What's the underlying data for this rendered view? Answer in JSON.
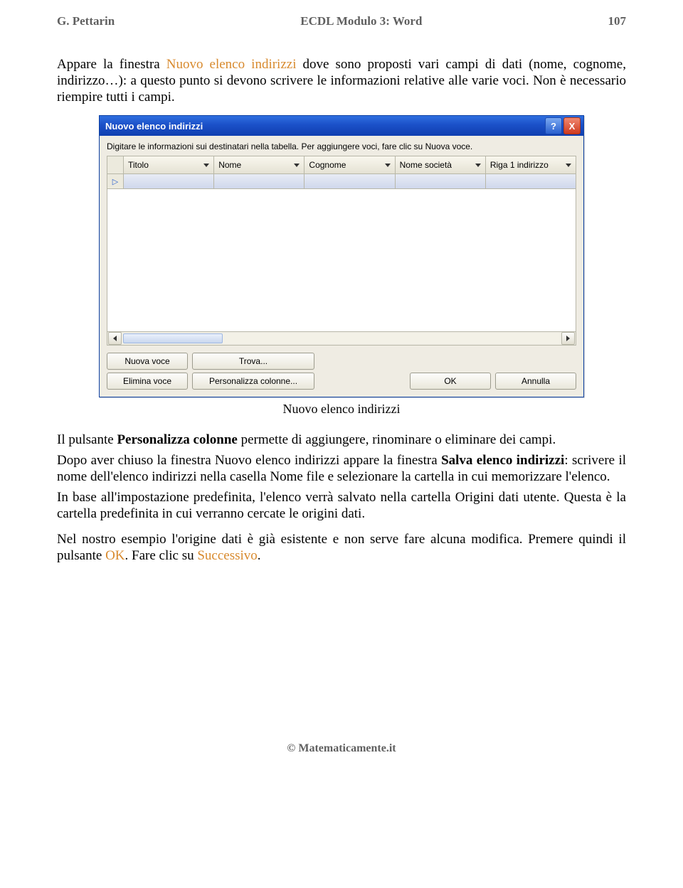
{
  "header": {
    "left": "G. Pettarin",
    "center": "ECDL Modulo 3: Word",
    "right": "107"
  },
  "paragraphs": {
    "intro_a": "Appare la finestra ",
    "intro_hi": "Nuovo elenco indirizzi",
    "intro_b": " dove sono proposti vari campi di dati (nome, cognome, indirizzo…): a questo punto si devono scrivere le informazioni relative alle varie voci. Non è necessario riempire tutti i campi.",
    "caption": "Nuovo elenco indirizzi",
    "p2_a": "Il pulsante ",
    "p2_bold": "Personalizza colonne",
    "p2_b": " permette di aggiungere, rinominare o eliminare dei campi.",
    "p3_a": "Dopo aver chiuso la finestra Nuovo elenco indirizzi appare la finestra ",
    "p3_bold": "Salva elenco indirizzi",
    "p3_b": ": scrivere il nome dell'elenco indirizzi nella casella Nome file e selezionare la cartella in cui memorizzare l'elenco.",
    "p4": "In base all'impostazione predefinita, l'elenco verrà salvato nella cartella Origini dati utente. Questa è la cartella predefinita in cui verranno cercate le origini dati.",
    "p5_a": "Nel nostro esempio l'origine dati è già esistente e non serve fare alcuna modifica. Premere quindi il pulsante ",
    "p5_hi1": "OK",
    "p5_b": ". Fare clic su ",
    "p5_hi2": "Successivo",
    "p5_c": "."
  },
  "dialog": {
    "title": "Nuovo elenco indirizzi",
    "instruction": "Digitare le informazioni sui destinatari nella tabella. Per aggiungere voci, fare clic su Nuova voce.",
    "columns": [
      "Titolo",
      "Nome",
      "Cognome",
      "Nome società",
      "Riga 1 indirizzo"
    ],
    "buttons": {
      "new": "Nuova voce",
      "find": "Trova...",
      "delete": "Elimina voce",
      "customize": "Personalizza colonne...",
      "ok": "OK",
      "cancel": "Annulla"
    },
    "help_icon": "?",
    "close_icon": "X",
    "row_marker": "▷"
  },
  "footer": "© Matematicamente.it"
}
